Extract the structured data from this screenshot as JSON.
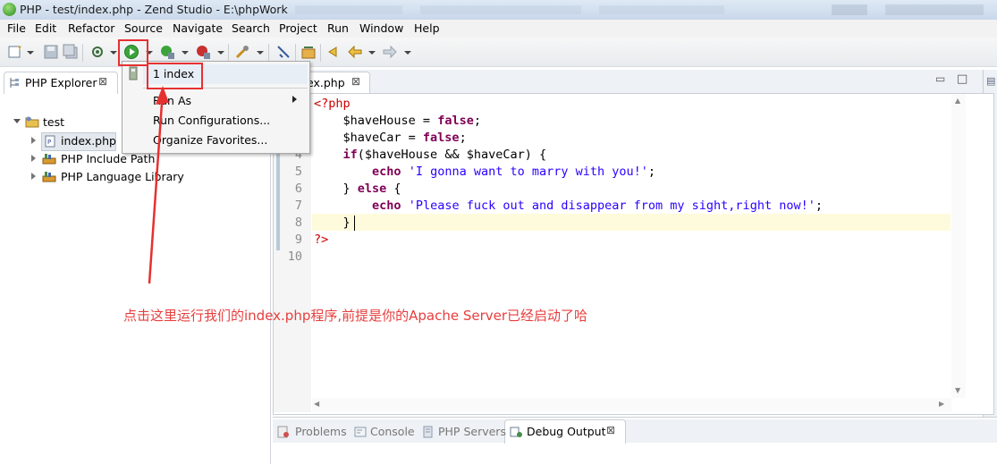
{
  "window": {
    "title": "PHP - test/index.php - Zend Studio - E:\\phpWork"
  },
  "menu": [
    "File",
    "Edit",
    "Refactor",
    "Source",
    "Navigate",
    "Search",
    "Project",
    "Run",
    "Window",
    "Help"
  ],
  "explorer": {
    "tab_label": "PHP Explorer",
    "tree": {
      "project": "test",
      "file": "index.php",
      "include_path": "PHP Include Path",
      "language_library": "PHP Language Library"
    }
  },
  "editor": {
    "tab_label": "index.php",
    "tab_label_visible": "ex.php",
    "line_numbers": [
      "1",
      "2",
      "3",
      "4",
      "5",
      "6",
      "7",
      "8",
      "9",
      "10"
    ],
    "code": {
      "l1": "<?php",
      "l2_var": "$haveHouse = ",
      "l2_kw": "false",
      "l2_end": ";",
      "l3_var": "$haveCar = ",
      "l3_kw": "false",
      "l3_end": ";",
      "l4_kw": "if",
      "l4_rest": "($haveHouse && $haveCar) {",
      "l5_kw": "echo",
      "l5_str": "'I gonna want to marry with you!'",
      "l5_end": ";",
      "l6_pre": "} ",
      "l6_kw": "else",
      "l6_end": " {",
      "l7_kw": "echo",
      "l7_str": "'Please fuck out and disappear from my sight,right now!'",
      "l7_end": ";",
      "l8": "}",
      "l9": "?>"
    }
  },
  "run_dropdown": {
    "items": [
      "1 index",
      "Run As",
      "Run Configurations...",
      "Organize Favorites..."
    ]
  },
  "bottom_panel": {
    "tabs": [
      "Problems",
      "Console",
      "PHP Servers",
      "Debug Output"
    ],
    "active_tab": "Debug Output"
  },
  "annotation": "点击这里运行我们的index.php程序,前提是你的Apache Server已经启动了哈",
  "colors": {
    "annotation": "#e83e3e",
    "keyword": "#7f0055",
    "string": "#2a00ff",
    "php_tag": "#cc0000",
    "current_line": "#fdfbdc"
  }
}
